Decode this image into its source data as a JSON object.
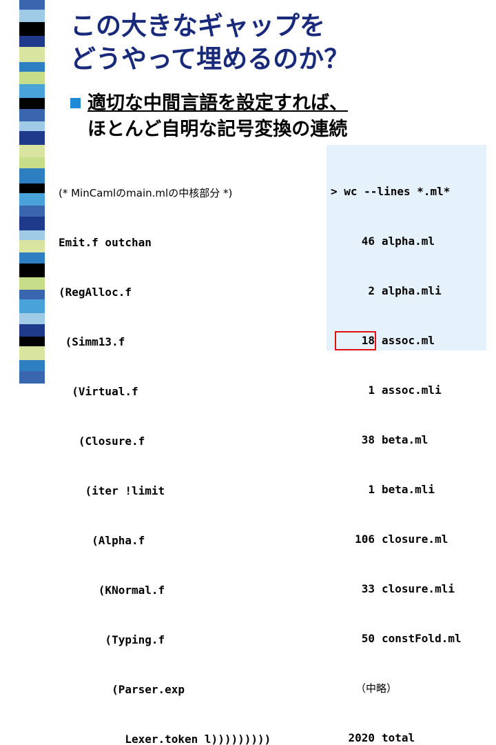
{
  "slide": {
    "title_line1": "この大きなギャップを",
    "title_line2": "どうやって埋めるのか？",
    "bullet_line1": "適切な中間言語を設定すれば、",
    "bullet_line2": "ほとんど自明な記号変換の連続",
    "code_comment": "(* MinCamlのmain.mlの中核部分 *)",
    "code_lines": [
      "Emit.f outchan",
      "(RegAlloc.f",
      " (Simm13.f",
      "  (Virtual.f",
      "   (Closure.f",
      "    (iter !limit",
      "     (Alpha.f",
      "      (KNormal.f",
      "       (Typing.f",
      "        (Parser.exp",
      "          Lexer.token l)))))))))"
    ],
    "wc_command": "> wc --lines *.ml*",
    "wc_rows": [
      {
        "num": "46",
        "file": "alpha.ml"
      },
      {
        "num": "2",
        "file": "alpha.mli"
      },
      {
        "num": "18",
        "file": "assoc.ml"
      },
      {
        "num": "1",
        "file": "assoc.mli"
      },
      {
        "num": "38",
        "file": "beta.ml"
      },
      {
        "num": "1",
        "file": "beta.mli"
      },
      {
        "num": "106",
        "file": "closure.ml"
      },
      {
        "num": "33",
        "file": "closure.mli"
      },
      {
        "num": "50",
        "file": "constFold.ml"
      }
    ],
    "wc_ellipsis": "（中略）",
    "wc_total_num": "2020",
    "wc_total_label": "total"
  },
  "colors": {
    "title": "#1a2a7a",
    "bullet": "#1f8ad6",
    "panel": "#e6f2fb",
    "highlight_border": "#e01010"
  }
}
